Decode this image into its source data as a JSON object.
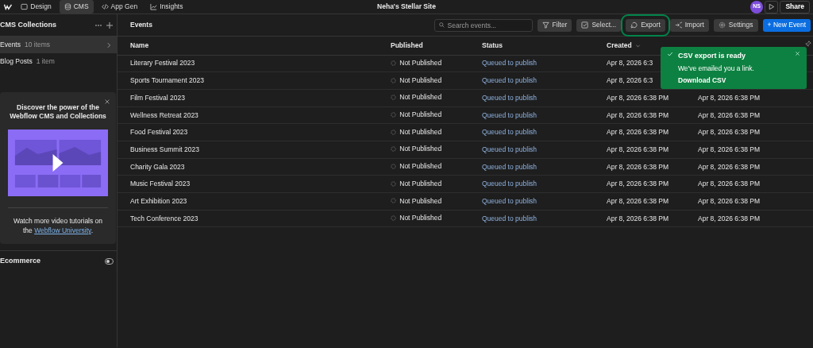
{
  "topbar": {
    "tabs": [
      {
        "label": "Design",
        "selected": false
      },
      {
        "label": "CMS",
        "selected": true
      },
      {
        "label": "App Gen",
        "selected": false
      },
      {
        "label": "Insights",
        "selected": false
      }
    ],
    "site_title": "Neha's Stellar Site",
    "avatar": "NS",
    "share": "Share"
  },
  "sidebar": {
    "title": "CMS Collections",
    "collections": [
      {
        "name": "Events",
        "count": "10 items",
        "selected": true
      },
      {
        "name": "Blog Posts",
        "count": "1 item",
        "selected": false
      }
    ],
    "promo": {
      "title": "Discover the power of the Webflow CMS and Collections",
      "text": "Watch more video tutorials on the",
      "link": "Webflow University",
      "after": "."
    },
    "ecommerce": {
      "label": "Ecommerce",
      "on": false
    }
  },
  "main": {
    "title": "Events",
    "search": {
      "placeholder": "Search events..."
    },
    "buttons": [
      {
        "label": "Filter",
        "kind": "plain",
        "highlighted": false
      },
      {
        "label": "Select...",
        "kind": "plain",
        "highlighted": false
      },
      {
        "label": "Export",
        "kind": "plain",
        "highlighted": true
      },
      {
        "label": "Import",
        "kind": "plain",
        "highlighted": false
      },
      {
        "label": "Settings",
        "kind": "plain",
        "highlighted": false
      },
      {
        "label": "+ New Event",
        "kind": "primary",
        "highlighted": false
      }
    ],
    "table": {
      "columns": [
        "Name",
        "Published",
        "Status",
        "Created"
      ],
      "rows": [
        {
          "name": "Literary Festival 2023",
          "published": "Not Published",
          "status": "Queued to publish",
          "created": "Apr 8, 2026 6:3"
        },
        {
          "name": "Sports Tournament 2023",
          "published": "Not Published",
          "status": "Queued to publish",
          "created": "Apr 8, 2026 6:3"
        },
        {
          "name": "Film Festival 2023",
          "published": "Not Published",
          "status": "Queued to publish",
          "created": "Apr 8, 2026 6:38 PM",
          "modified": "Apr 8, 2026 6:38 PM"
        },
        {
          "name": "Wellness Retreat 2023",
          "published": "Not Published",
          "status": "Queued to publish",
          "created": "Apr 8, 2026 6:38 PM",
          "modified": "Apr 8, 2026 6:38 PM"
        },
        {
          "name": "Food Festival 2023",
          "published": "Not Published",
          "status": "Queued to publish",
          "created": "Apr 8, 2026 6:38 PM",
          "modified": "Apr 8, 2026 6:38 PM"
        },
        {
          "name": "Business Summit 2023",
          "published": "Not Published",
          "status": "Queued to publish",
          "created": "Apr 8, 2026 6:38 PM",
          "modified": "Apr 8, 2026 6:38 PM"
        },
        {
          "name": "Charity Gala 2023",
          "published": "Not Published",
          "status": "Queued to publish",
          "created": "Apr 8, 2026 6:38 PM",
          "modified": "Apr 8, 2026 6:38 PM"
        },
        {
          "name": "Music Festival 2023",
          "published": "Not Published",
          "status": "Queued to publish",
          "created": "Apr 8, 2026 6:38 PM",
          "modified": "Apr 8, 2026 6:38 PM"
        },
        {
          "name": "Art Exhibition 2023",
          "published": "Not Published",
          "status": "Queued to publish",
          "created": "Apr 8, 2026 6:38 PM",
          "modified": "Apr 8, 2026 6:38 PM"
        },
        {
          "name": "Tech Conference 2023",
          "published": "Not Published",
          "status": "Queued to publish",
          "created": "Apr 8, 2026 6:38 PM",
          "modified": "Apr 8, 2026 6:38 PM"
        }
      ]
    },
    "toast": {
      "title": "CSV export is ready",
      "text": "We've emailed you a link.",
      "link": "Download CSV"
    }
  }
}
